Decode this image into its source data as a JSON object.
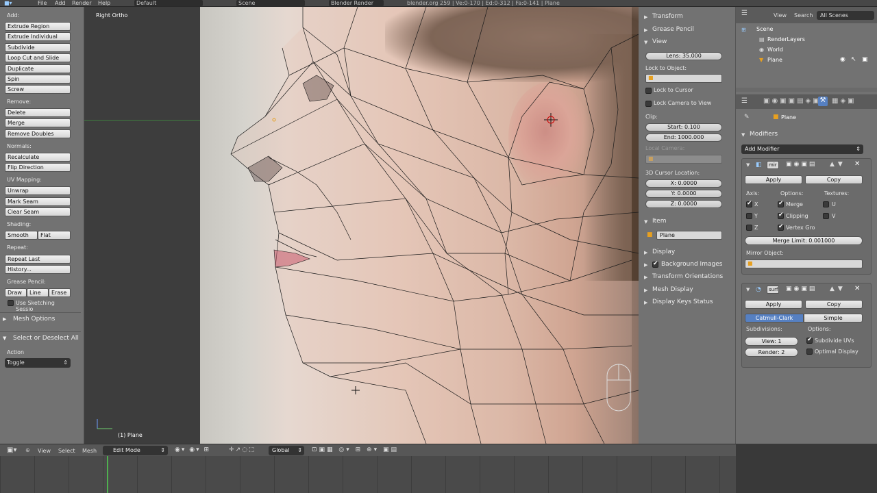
{
  "topbar": {
    "menu": [
      "File",
      "Add",
      "Render",
      "Help"
    ],
    "layout": "Default",
    "scene": "Scene",
    "engine": "Blender Render",
    "stats": "blender.org 259 | Ve:0-170 | Ed:0-312 | Fa:0-141 | Plane"
  },
  "tools": {
    "add_label": "Add:",
    "add": [
      "Extrude Region",
      "Extrude Individual",
      "Subdivide",
      "Loop Cut and Slide",
      "Duplicate",
      "Spin",
      "Screw"
    ],
    "remove_label": "Remove:",
    "remove": [
      "Delete",
      "Merge",
      "Remove Doubles"
    ],
    "normals_label": "Normals:",
    "normals": [
      "Recalculate",
      "Flip Direction"
    ],
    "uv_label": "UV Mapping:",
    "uv": [
      "Unwrap",
      "Mark Seam",
      "Clear Seam"
    ],
    "shading_label": "Shading:",
    "smooth": "Smooth",
    "flat": "Flat",
    "repeat_label": "Repeat:",
    "repeat": [
      "Repeat Last",
      "History..."
    ],
    "gp_label": "Grease Pencil:",
    "draw": "Draw",
    "line": "Line",
    "erase": "Erase",
    "sketch": "Use Sketching Sessio",
    "mesh_options": "Mesh Options",
    "op_title": "Select or Deselect All",
    "action_label": "Action",
    "action_value": "Toggle"
  },
  "viewport": {
    "view_name": "Right Ortho",
    "object_label": "(1) Plane"
  },
  "nprops": {
    "transform": "Transform",
    "grease": "Grease Pencil",
    "view": "View",
    "lens": "Lens: 35.000",
    "lock_obj": "Lock to Object:",
    "lock_cursor": "Lock to Cursor",
    "lock_cam": "Lock Camera to View",
    "clip": "Clip:",
    "clip_start": "Start: 0.100",
    "clip_end": "End: 1000.000",
    "local_cam": "Local Camera:",
    "cursor_loc": "3D Cursor Location:",
    "cx": "X: 0.0000",
    "cy": "Y: 0.0000",
    "cz": "Z: 0.0000",
    "item": "Item",
    "item_name": "Plane",
    "display": "Display",
    "bg_images": "Background Images",
    "trans_orient": "Transform Orientations",
    "mesh_display": "Mesh Display",
    "keys_status": "Display Keys Status"
  },
  "outliner": {
    "view": "View",
    "search": "Search",
    "filter": "All Scenes",
    "scene": "Scene",
    "render_layers": "RenderLayers",
    "world": "World",
    "plane": "Plane"
  },
  "props": {
    "breadcrumb": "Plane",
    "modifiers": "Modifiers",
    "add_modifier": "Add Modifier",
    "mirror": {
      "name": "mir",
      "apply": "Apply",
      "copy": "Copy",
      "axis": "Axis:",
      "options": "Options:",
      "textures": "Textures:",
      "x": "X",
      "y": "Y",
      "z": "Z",
      "merge": "Merge",
      "clipping": "Clipping",
      "vgroup": "Vertex Gro",
      "u": "U",
      "v": "V",
      "merge_limit": "Merge Limit: 0.001000",
      "mirror_object": "Mirror Object:"
    },
    "subsurf": {
      "name": "surf",
      "apply": "Apply",
      "copy": "Copy",
      "catmull": "Catmull-Clark",
      "simple": "Simple",
      "subdivisions": "Subdivisions:",
      "options": "Options:",
      "view": "View: 1",
      "render": "Render: 2",
      "sub_uvs": "Subdivide UVs",
      "optimal": "Optimal Display"
    }
  },
  "vpheader": {
    "view": "View",
    "select": "Select",
    "mesh": "Mesh",
    "mode": "Edit Mode",
    "orient": "Global"
  },
  "colors": {
    "accent": "#5680c2",
    "panel": "#727272",
    "timeline": "#4a4a4a"
  }
}
